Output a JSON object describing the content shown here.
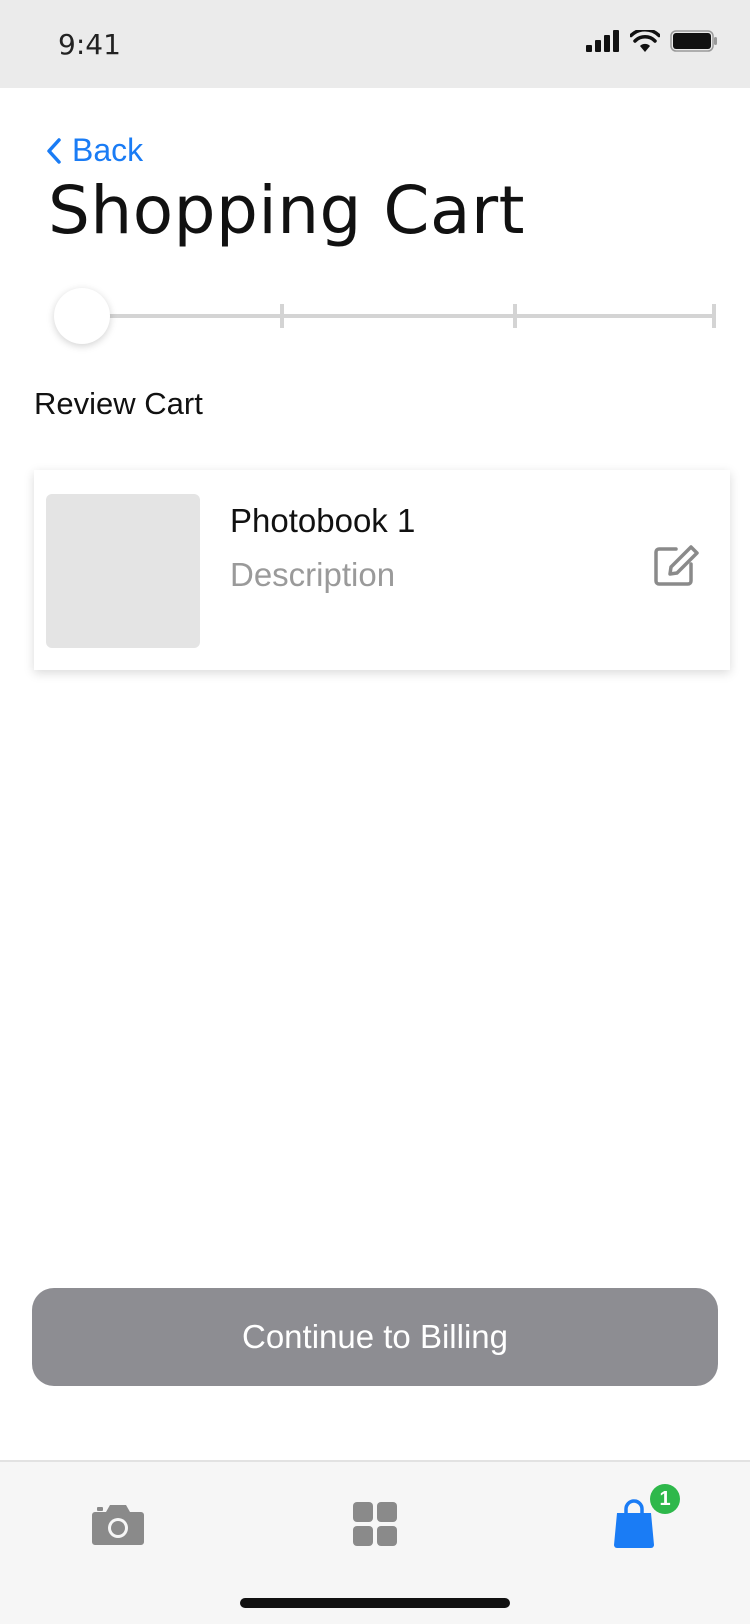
{
  "status_bar": {
    "time": "9:41"
  },
  "nav": {
    "back_label": "Back"
  },
  "page": {
    "title": "Shopping Cart",
    "step_label": "Review Cart"
  },
  "progress": {
    "current_step": 1,
    "total_steps": 4
  },
  "cart": {
    "items": [
      {
        "title": "Photobook 1",
        "description": "Description"
      }
    ]
  },
  "actions": {
    "continue_label": "Continue to Billing"
  },
  "tab_bar": {
    "items": [
      "camera-icon",
      "grid-icon",
      "shopping-bag-icon"
    ],
    "cart_badge": "1",
    "active_color": "#1a7cf5",
    "inactive_color": "#8a8a8a"
  },
  "colors": {
    "accent": "#1a7cf5",
    "badge": "#2eb84b",
    "button_disabled": "#8d8d92"
  }
}
